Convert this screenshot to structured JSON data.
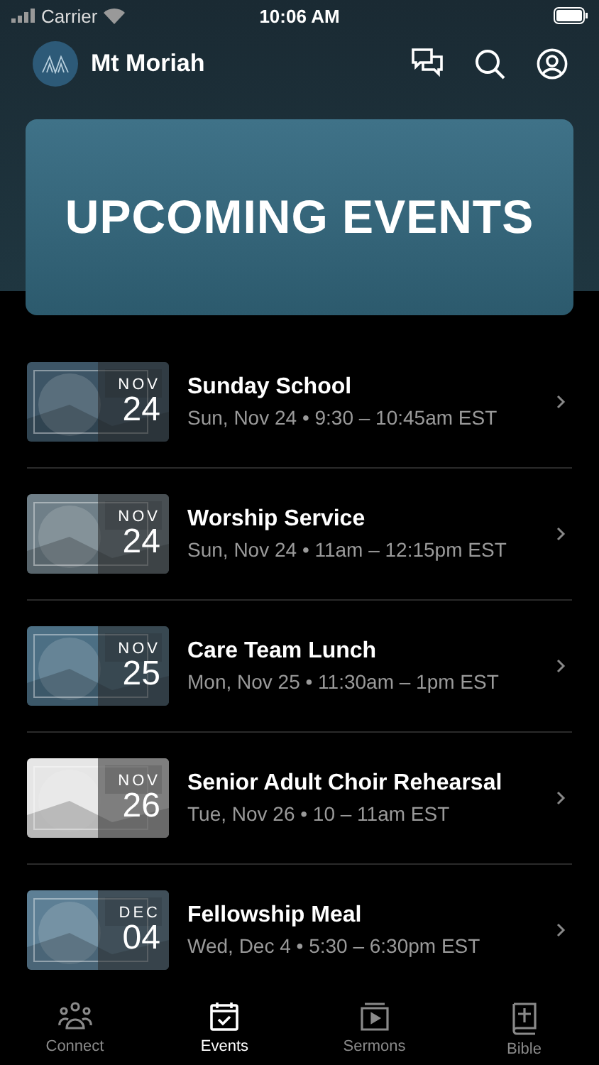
{
  "status_bar": {
    "carrier": "Carrier",
    "time": "10:06 AM"
  },
  "header": {
    "title": "Mt Moriah"
  },
  "banner": {
    "title": "UPCOMING EVENTS"
  },
  "events": [
    {
      "title": "Sunday School",
      "details": "Sun, Nov 24 • 9:30 – 10:45am EST",
      "month": "NOV",
      "day": "24"
    },
    {
      "title": "Worship Service",
      "details": "Sun, Nov 24 • 11am – 12:15pm EST",
      "month": "NOV",
      "day": "24"
    },
    {
      "title": "Care Team Lunch",
      "details": "Mon, Nov 25 • 11:30am – 1pm EST",
      "month": "NOV",
      "day": "25"
    },
    {
      "title": "Senior Adult Choir Rehearsal",
      "details": "Tue, Nov 26 • 10 – 11am EST",
      "month": "NOV",
      "day": "26"
    },
    {
      "title": "Fellowship Meal",
      "details": "Wed, Dec 4 • 5:30 – 6:30pm EST",
      "month": "DEC",
      "day": "04"
    }
  ],
  "tabs": [
    {
      "label": "Connect",
      "kind": "people",
      "selected": false
    },
    {
      "label": "Events",
      "kind": "calendar",
      "selected": true
    },
    {
      "label": "Sermons",
      "kind": "play",
      "selected": false
    },
    {
      "label": "Bible",
      "kind": "book",
      "selected": false
    }
  ]
}
